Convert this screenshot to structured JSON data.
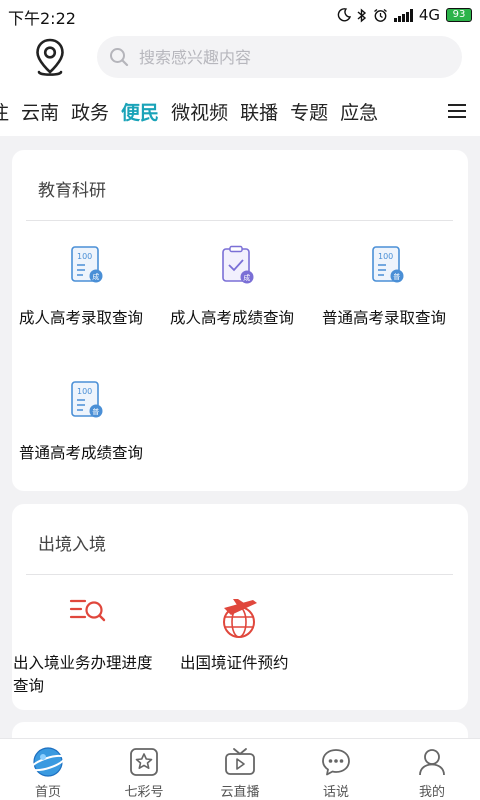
{
  "status": {
    "time": "下午2:22",
    "network": "4G",
    "battery": "93"
  },
  "search": {
    "placeholder": "搜索感兴趣内容"
  },
  "tabs": [
    {
      "label": "注"
    },
    {
      "label": "云南"
    },
    {
      "label": "政务"
    },
    {
      "label": "便民",
      "active": true
    },
    {
      "label": "微视频"
    },
    {
      "label": "联播"
    },
    {
      "label": "专题"
    },
    {
      "label": "应急"
    }
  ],
  "sections": [
    {
      "title": "教育科研",
      "items": [
        {
          "label": "成人高考录取查询",
          "icon": "exam-score-icon"
        },
        {
          "label": "成人高考成绩查询",
          "icon": "clipboard-check-icon"
        },
        {
          "label": "普通高考录取查询",
          "icon": "exam-score-icon"
        },
        {
          "label": "普通高考成绩查询",
          "icon": "exam-score-icon"
        }
      ]
    },
    {
      "title": "出境入境",
      "items": [
        {
          "label": "出入境业务办理进度查询",
          "icon": "list-search-icon"
        },
        {
          "label": "出国境证件预约",
          "icon": "plane-globe-icon"
        }
      ]
    }
  ],
  "bottom_nav": [
    {
      "label": "首页",
      "icon": "home-planet-icon",
      "active": true
    },
    {
      "label": "七彩号",
      "icon": "star-badge-icon"
    },
    {
      "label": "云直播",
      "icon": "tv-play-icon"
    },
    {
      "label": "话说",
      "icon": "chat-bubble-icon"
    },
    {
      "label": "我的",
      "icon": "user-icon"
    }
  ],
  "colors": {
    "accent": "#1aa3b8",
    "alert_red": "#e0473c",
    "icon_blue": "#4a8fd6",
    "icon_purple": "#7a6fd6"
  }
}
